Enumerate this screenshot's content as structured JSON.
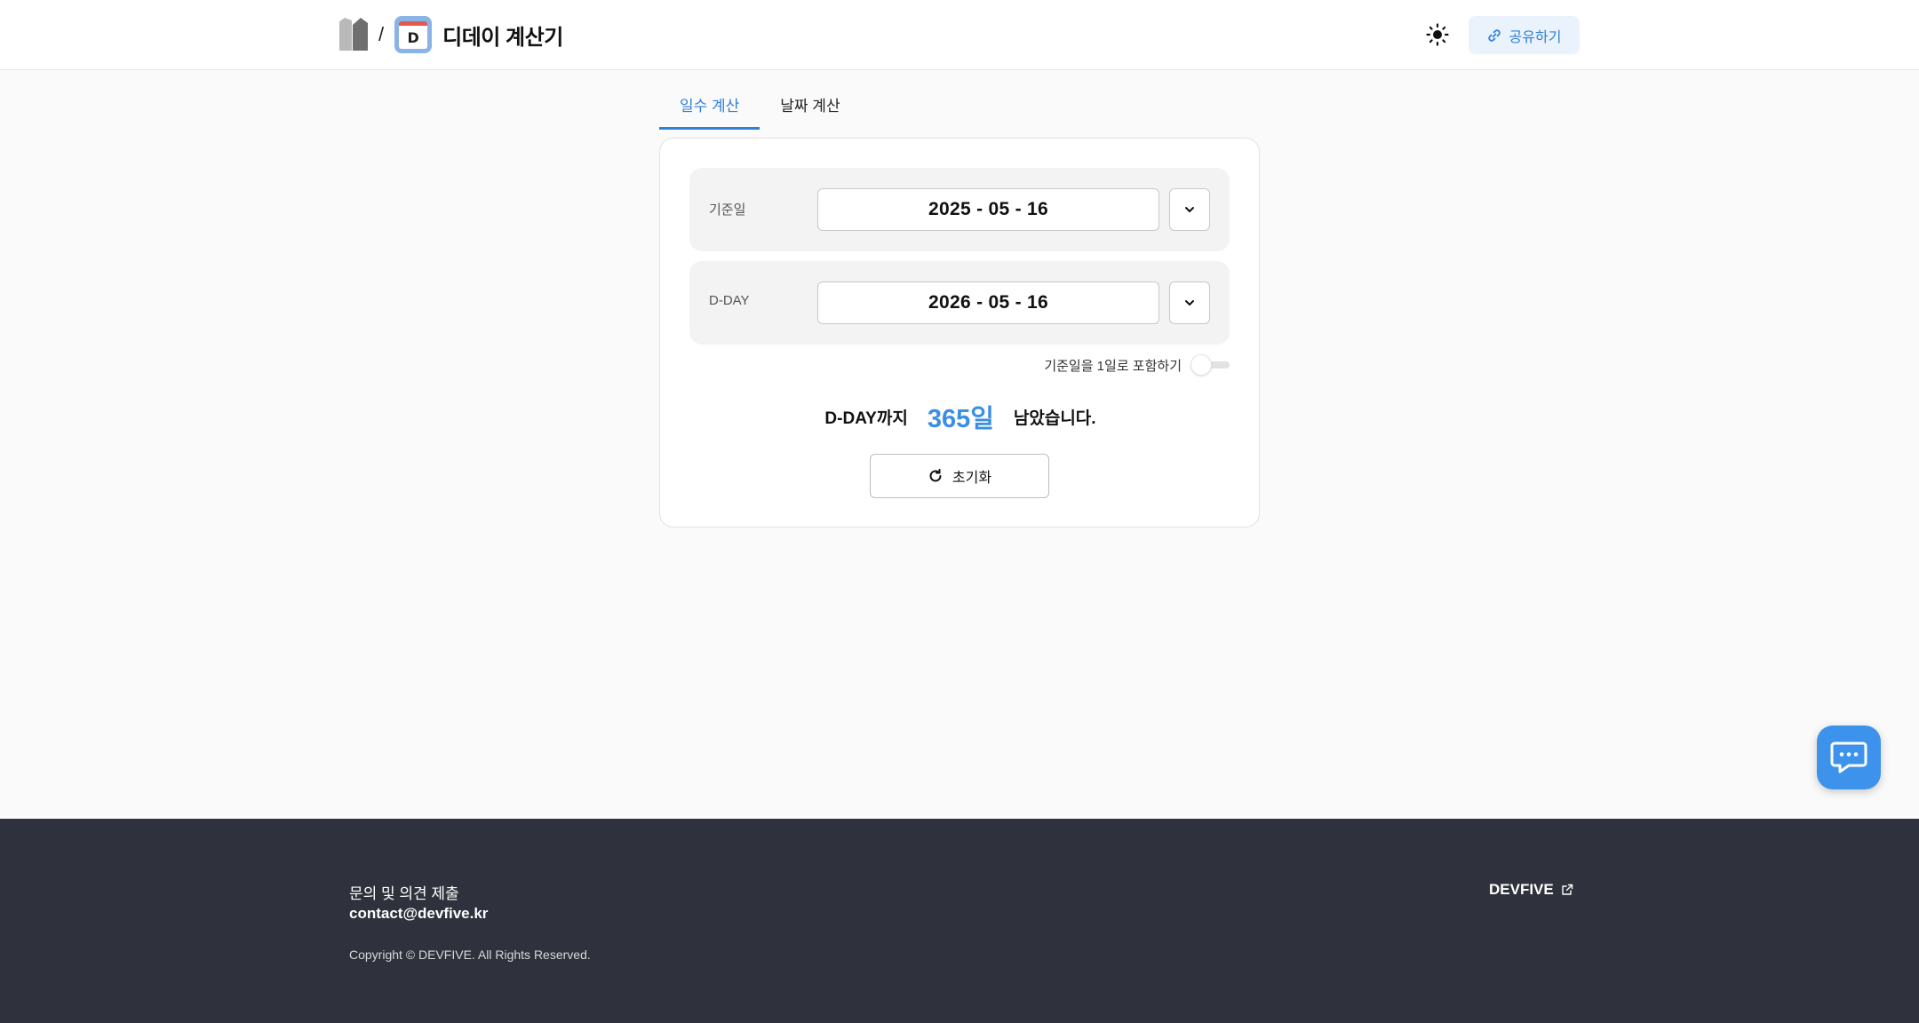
{
  "header": {
    "separator": "/",
    "app_icon_letter": "D",
    "app_title": "디데이 계산기",
    "share_label": "공유하기",
    "theme_icon": "sun-icon"
  },
  "tabs": [
    {
      "label": "일수 계산",
      "active": true
    },
    {
      "label": "날짜 계산",
      "active": false
    }
  ],
  "form": {
    "base_date_label": "기준일",
    "base_date_value": "2025 - 05 - 16",
    "dday_label": "D-DAY",
    "dday_value": "2026 - 05 - 16",
    "include_label": "기준일을 1일로 포함하기",
    "include_on": false
  },
  "result": {
    "prefix": "D-DAY까지",
    "days": "365일",
    "suffix": "남았습니다."
  },
  "reset_label": "초기화",
  "footer": {
    "inquiry": "문의 및 의견 제출",
    "email": "contact@devfive.kr",
    "copyright": "Copyright © DEVFIVE. All Rights Reserved.",
    "brand_link": "DEVFIVE"
  },
  "colors": {
    "accent": "#2f80d8",
    "result_days": "#3a8ee6",
    "footer_bg": "#2f313c",
    "chat_bg": "#3d93ec"
  }
}
